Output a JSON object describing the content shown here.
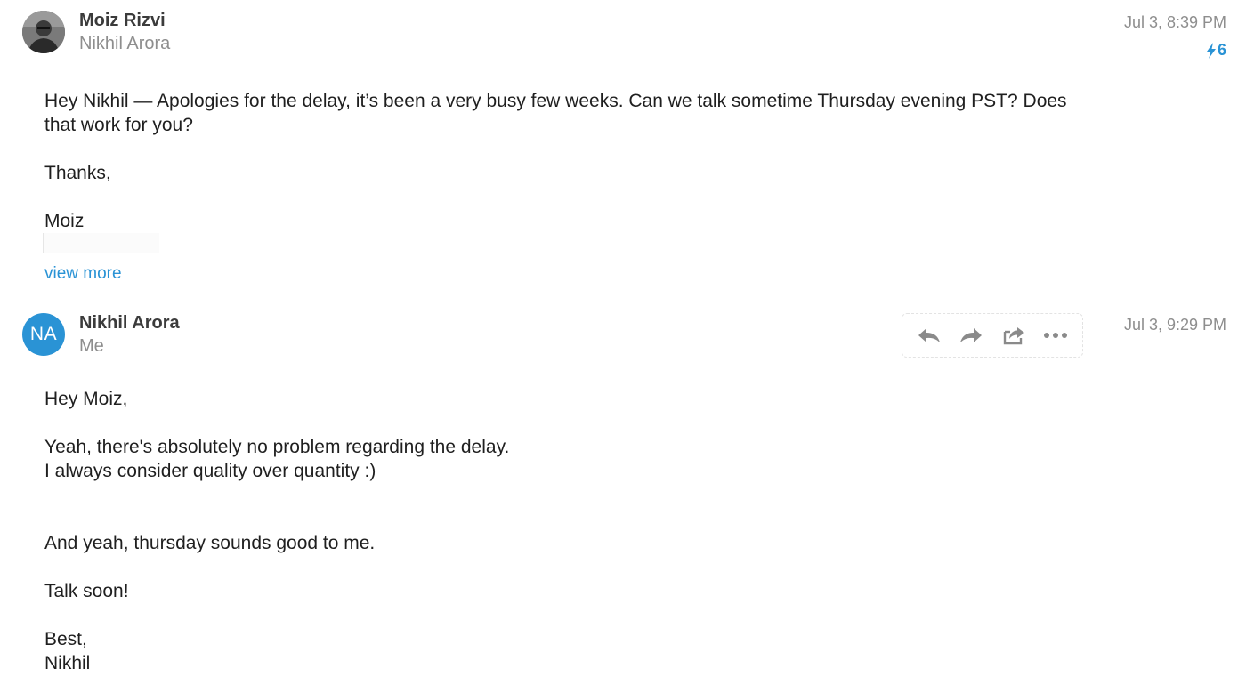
{
  "messages": [
    {
      "sender": "Moiz Rizvi",
      "recipient": "Nikhil Arora",
      "timestamp": "Jul 3, 8:39 PM",
      "thread_count": "6",
      "avatar": "photo",
      "body": [
        "Hey Nikhil — Apologies for the delay, it’s been a very busy few weeks. Can we talk sometime Thursday evening PST? Does",
        "that work for you?",
        "Thanks,",
        "Moiz"
      ],
      "view_more": "view more"
    },
    {
      "sender": "Nikhil Arora",
      "recipient": "Me",
      "timestamp": "Jul 3, 9:29 PM",
      "avatar_initials": "NA",
      "toolbar_icons": [
        "reply-icon",
        "forward-icon",
        "share-icon",
        "more-icon"
      ],
      "body": [
        "Hey Moiz,",
        "Yeah, there's absolutely no problem regarding the delay.",
        "I always consider quality over quantity :)",
        "And yeah, thursday sounds good to me.",
        "Talk soon!",
        "Best,",
        "Nikhil"
      ]
    }
  ],
  "colors": {
    "accent": "#2a93d5",
    "muted_text": "#8e8e8e",
    "body_text": "#1f1f1f",
    "icon": "#8a8a8a"
  }
}
